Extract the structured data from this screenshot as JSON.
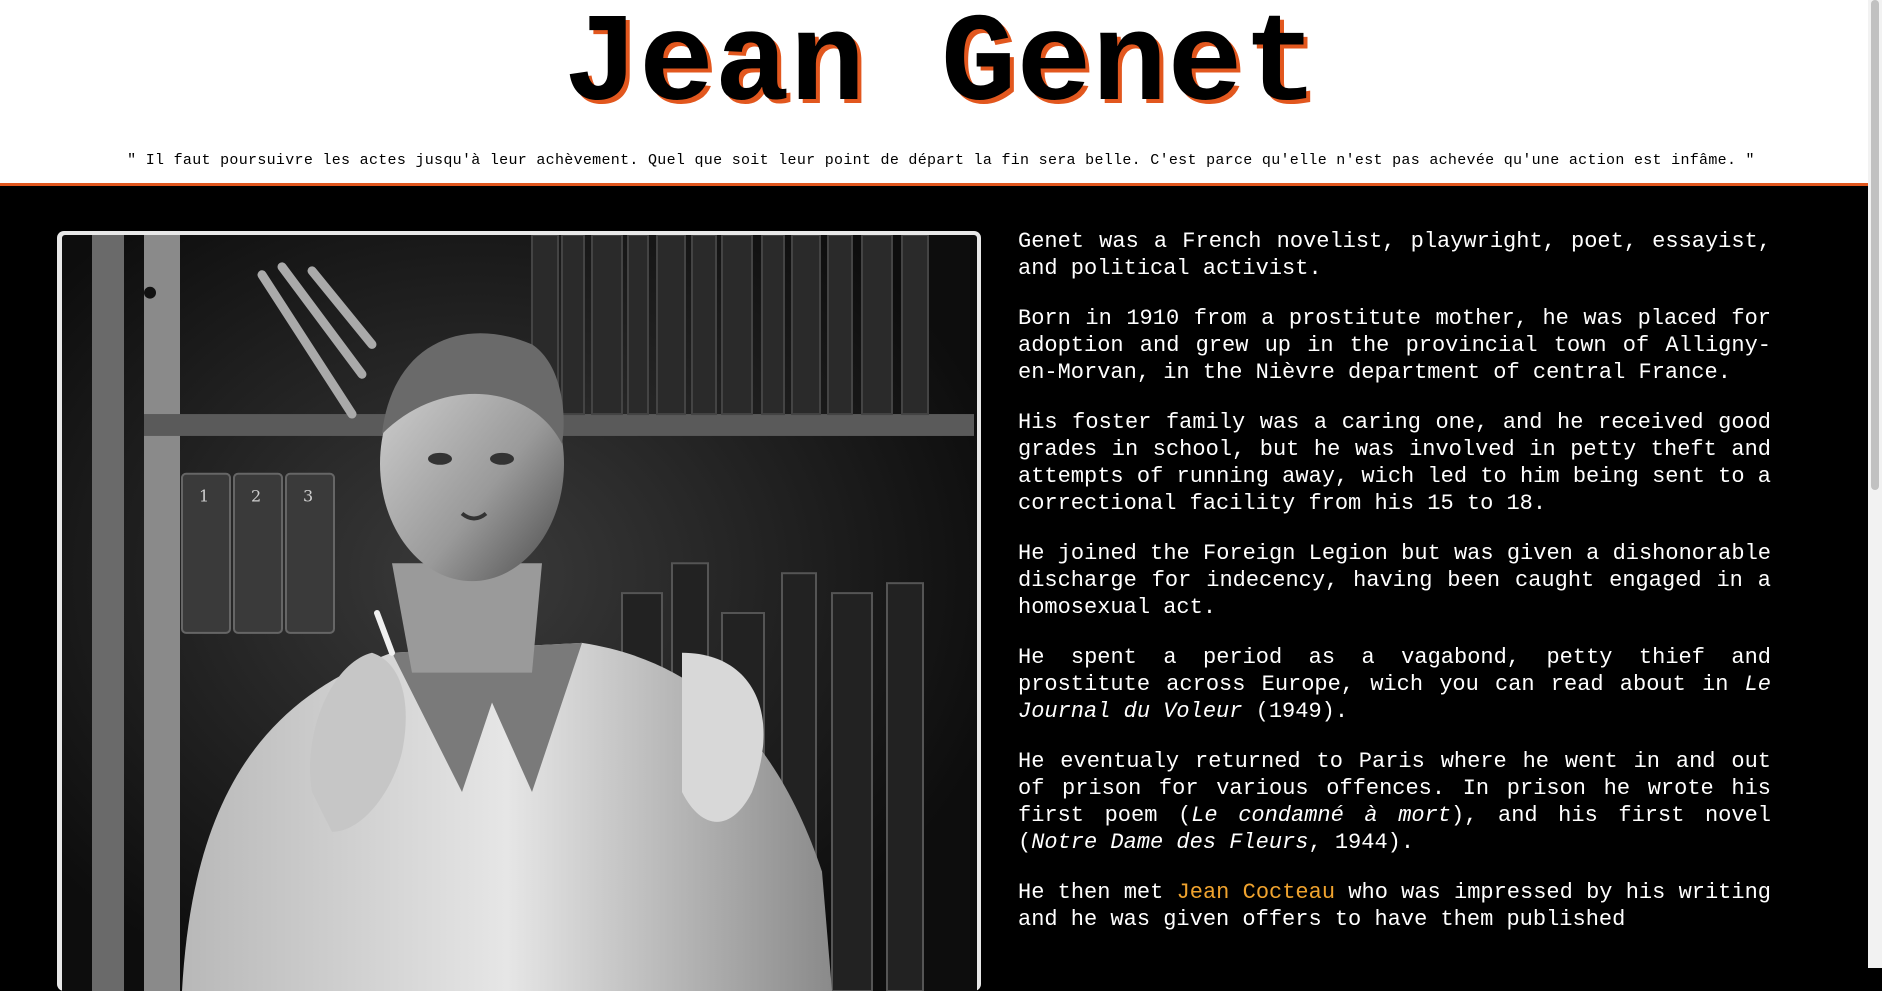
{
  "header": {
    "title": "Jean Genet",
    "quote": "\" Il faut poursuivre les actes jusqu'à leur achèvement. Quel que soit leur point de départ la fin sera belle. C'est parce qu'elle n'est pas achevée qu'une action est infâme. \""
  },
  "colors": {
    "accent": "#e2571e",
    "link": "#f0a32e",
    "background": "#000000"
  },
  "photo": {
    "icon": "portrait-photo"
  },
  "bio": {
    "p1": "Genet was a French novelist, playwright, poet, essayist, and political activist.",
    "p2": "Born in 1910 from a prostitute mother, he was placed for adoption and grew up in the provincial town of Alligny-en-Morvan, in the Nièvre department of central France.",
    "p3": "His foster family was a caring one, and he received good grades in school, but he was involved in petty theft and attempts of running away, wich led to him being sent to a correctional facility from his 15 to 18.",
    "p4": "He joined the Foreign Legion but was given a dishonorable discharge for indecency, having been caught engaged in a homosexual act.",
    "p5_a": "He spent a period as a vagabond, petty thief and prostitute across Europe, wich you can read about in ",
    "p5_title": "Le Journal du Voleur",
    "p5_b": " (1949).",
    "p6_a": "He eventualy returned to Paris where he went in and out of prison for various offences. In prison he wrote his first poem (",
    "p6_title1": "Le condamné à mort",
    "p6_b": "), and his first novel (",
    "p6_title2": "Notre Dame des Fleurs",
    "p6_c": ", 1944).",
    "p7_a": "He then met ",
    "p7_link": "Jean Cocteau",
    "p7_b": " who was impressed by his writing and he was given offers to have them published"
  }
}
